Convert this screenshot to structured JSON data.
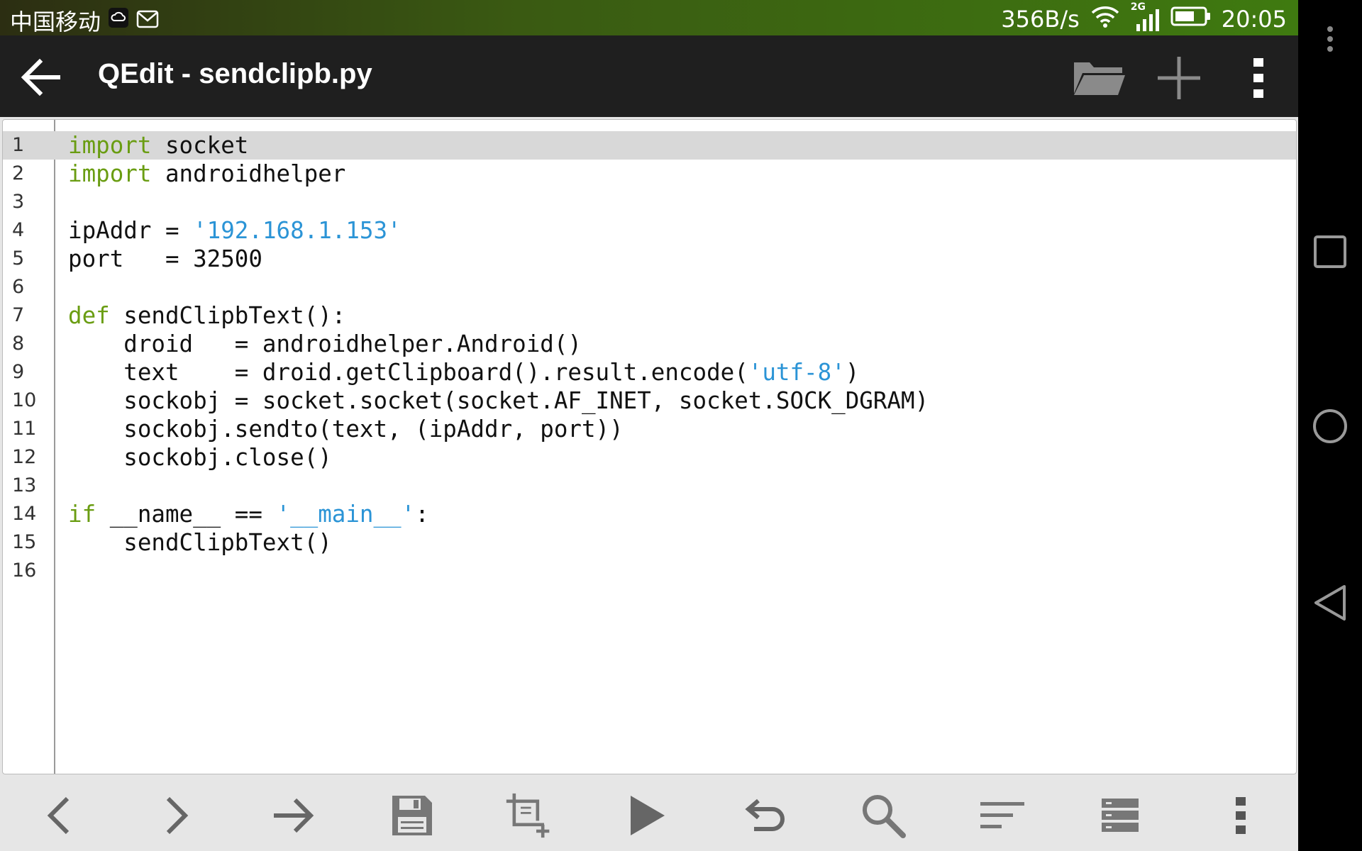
{
  "status_bar": {
    "carrier": "中国移动",
    "net_speed": "356B/s",
    "network_type": "2G",
    "time": "20:05"
  },
  "app_bar": {
    "title": "QEdit - sendclipb.py",
    "icons": [
      "back-arrow-icon",
      "folder-open-icon",
      "plus-icon",
      "overflow-menu-icon"
    ]
  },
  "editor": {
    "highlighted_line": 1,
    "syntax_colors": {
      "keyword": "#6a9d12",
      "string": "#2b94d6",
      "text": "#111111"
    },
    "lines": [
      {
        "num": "1",
        "tokens": [
          {
            "t": "import",
            "k": "kw"
          },
          {
            "t": " socket"
          }
        ]
      },
      {
        "num": "2",
        "tokens": [
          {
            "t": "import",
            "k": "kw"
          },
          {
            "t": " androidhelper"
          }
        ]
      },
      {
        "num": "3",
        "tokens": []
      },
      {
        "num": "4",
        "tokens": [
          {
            "t": "ipAddr = "
          },
          {
            "t": "'192.168.1.153'",
            "k": "str"
          }
        ]
      },
      {
        "num": "5",
        "tokens": [
          {
            "t": "port   = 32500"
          }
        ]
      },
      {
        "num": "6",
        "tokens": []
      },
      {
        "num": "7",
        "tokens": [
          {
            "t": "def",
            "k": "kw"
          },
          {
            "t": " sendClipbText():"
          }
        ]
      },
      {
        "num": "8",
        "tokens": [
          {
            "t": "    droid   = androidhelper.Android()"
          }
        ]
      },
      {
        "num": "9",
        "tokens": [
          {
            "t": "    text    = droid.getClipboard().result.encode("
          },
          {
            "t": "'utf-8'",
            "k": "str"
          },
          {
            "t": ")"
          }
        ]
      },
      {
        "num": "10",
        "tokens": [
          {
            "t": "    sockobj = socket.socket(socket.AF_INET, socket.SOCK_DGRAM)"
          }
        ]
      },
      {
        "num": "11",
        "tokens": [
          {
            "t": "    sockobj.sendto(text, (ipAddr, port))"
          }
        ]
      },
      {
        "num": "12",
        "tokens": [
          {
            "t": "    sockobj.close()"
          }
        ]
      },
      {
        "num": "13",
        "tokens": []
      },
      {
        "num": "14",
        "tokens": [
          {
            "t": "if",
            "k": "kw"
          },
          {
            "t": " __name__ == "
          },
          {
            "t": "'__main__'",
            "k": "str"
          },
          {
            "t": ":"
          }
        ]
      },
      {
        "num": "15",
        "tokens": [
          {
            "t": "    sendClipbText()"
          }
        ]
      },
      {
        "num": "16",
        "tokens": []
      }
    ]
  },
  "bottom_toolbar": {
    "icons": [
      "chevron-left-icon",
      "chevron-right-icon",
      "arrow-right-icon",
      "save-icon",
      "crop-add-icon",
      "run-icon",
      "undo-icon",
      "search-icon",
      "format-align-icon",
      "list-view-icon",
      "overflow-menu-icon"
    ]
  },
  "system_nav": {
    "icons": [
      "menu-dots-icon",
      "recents-square-icon",
      "home-circle-icon",
      "back-triangle-icon"
    ]
  }
}
